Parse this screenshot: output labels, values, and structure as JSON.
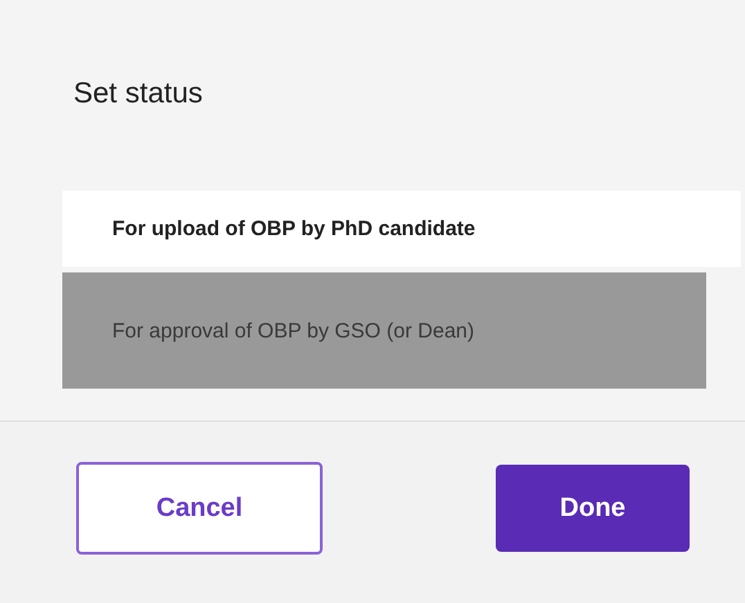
{
  "dialog": {
    "title": "Set status"
  },
  "options": [
    {
      "label": "For upload of OBP by PhD candidate",
      "selected": false
    },
    {
      "label": "For approval of OBP by GSO (or Dean)",
      "selected": true
    }
  ],
  "buttons": [
    {
      "label": "Cancel",
      "kind": "secondary"
    },
    {
      "label": "Done",
      "kind": "primary"
    }
  ]
}
